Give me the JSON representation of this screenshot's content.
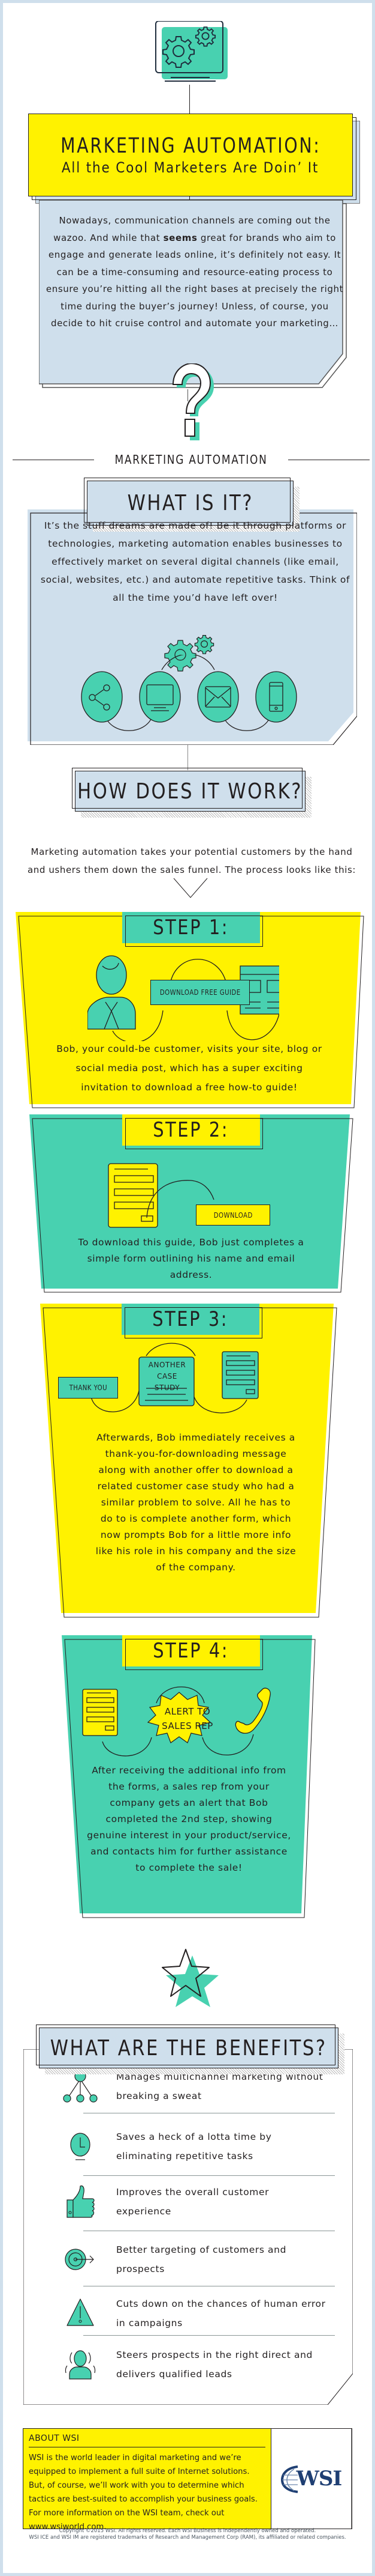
{
  "colors": {
    "teal": "#48d1b0",
    "yellow": "#fff200",
    "light_blue": "#cfdfec",
    "ink": "#231f20",
    "wsi_blue": "#1f3f73"
  },
  "hero": {
    "icon": "monitor-gears-icon",
    "title": "MARKETING AUTOMATION:",
    "subtitle": "All the Cool Marketers Are Doin’ It"
  },
  "intro": {
    "text_before_bold": "Nowadays, communication channels are coming out the wazoo. And while that ",
    "bold": "seems",
    "text_after_bold": " great for brands who aim to engage and generate leads online, it’s definitely not easy.  It can be a time-consuming and resource-eating process to ensure you’re hitting all the right bases at precisely the right time during the buyer’s journey! Unless, of course, you decide to hit cruise control and automate your marketing…"
  },
  "question_icon": "question-mark-icon",
  "section_label": "MARKETING AUTOMATION",
  "what_is_it": {
    "heading": "WHAT IS IT?",
    "text": "It’s the stuff dreams are made of! Be it through platforms or technologies, marketing automation enables businesses to effectively market on several digital channels (like email, social, websites, etc.) and automate repetitive tasks. Think of all the time you’d have left over!",
    "gears_icon": "gears-icon",
    "channels": [
      {
        "icon": "share-icon",
        "name": "social"
      },
      {
        "icon": "monitor-icon",
        "name": "website"
      },
      {
        "icon": "envelope-icon",
        "name": "email"
      },
      {
        "icon": "mobile-phone-icon",
        "name": "mobile"
      }
    ]
  },
  "how_it_works": {
    "heading": "HOW DOES IT WORK?",
    "intro": "Marketing automation takes your potential customers by the hand and ushers them down the sales funnel. The process looks like this:",
    "steps": [
      {
        "label": "STEP 1:",
        "button": "DOWNLOAD FREE GUIDE",
        "text": "Bob, your could-be customer, visits your site, blog or social media post, which has a super exciting invitation to download a free how-to guide!"
      },
      {
        "label": "STEP 2:",
        "button": "DOWNLOAD",
        "text": "To download this guide, Bob just completes a simple form outlining his name and email address."
      },
      {
        "label": "STEP 3:",
        "button": "THANK YOU",
        "card": "ANOTHER CASE STUDY",
        "text": "Afterwards, Bob immediately receives a thank-you-for-downloading message along with another offer to download a related customer case study who had a similar problem to solve. All he has to do to is complete another form, which now prompts Bob for a little more info like his role in his company and the size of the company."
      },
      {
        "label": "STEP 4:",
        "badge": "ALERT TO SALES REP",
        "text": "After receiving the additional info from the forms, a sales rep from your company gets an alert that Bob completed the 2nd step, showing genuine interest in your product/service, and contacts him for further assistance to complete the sale!"
      }
    ]
  },
  "star_icon": "star-icon",
  "benefits": {
    "heading": "WHAT ARE THE BENEFITS?",
    "items": [
      {
        "icon": "network-icon",
        "text": "Manages multichannel marketing without breaking a sweat"
      },
      {
        "icon": "clock-icon",
        "text": "Saves a heck of a lotta time by eliminating repetitive tasks"
      },
      {
        "icon": "thumbs-up-icon",
        "text": "Improves the overall customer experience"
      },
      {
        "icon": "target-icon",
        "text": "Better targeting of customers and prospects"
      },
      {
        "icon": "warning-icon",
        "text": "Cuts down on the chances of human error in campaigns"
      },
      {
        "icon": "person-icon",
        "text": "Steers prospects in the right direct and delivers qualified leads"
      }
    ]
  },
  "about": {
    "title": "ABOUT WSI",
    "text": "WSI is the world leader in digital marketing and we’re equipped to implement a full suite of Internet solutions. But, of course, we’ll work with you to determine which tactics are best-suited to accomplish your business goals. For more information on the WSI team, check out www.wsiworld.com.",
    "logo_text": "WSI"
  },
  "copyright": {
    "line1": "Copyright ©2015 WSI.  All rights reserved.  Each WSI  Business is independently owned and operated.",
    "line2": "WSI ICE and WSI IM are registered trademarks of Research and Management Corp (RAM), its affiliated or related companies."
  }
}
